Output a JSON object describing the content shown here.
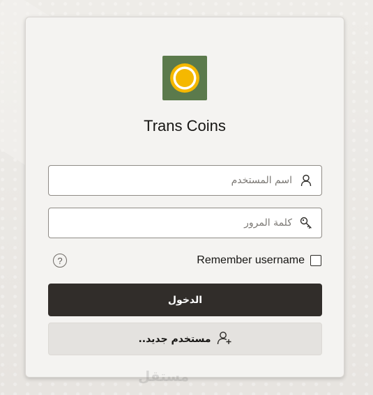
{
  "app": {
    "title": "Trans Coins"
  },
  "login": {
    "username_placeholder": "اسم المستخدم",
    "password_placeholder": "كلمة المرور",
    "remember_label": "Remember username",
    "remember_checked": false,
    "help_symbol": "?",
    "login_button": "الدخول",
    "new_user_button": "مستخدم جديد.."
  },
  "watermark": "مستقل",
  "icons": {
    "logo": "coin-logo-icon",
    "username": "user-icon",
    "password": "key-icon",
    "help": "help-icon",
    "new_user": "add-user-icon"
  },
  "colors": {
    "logo_bg": "#5b7a4c",
    "logo_ring": "#f5b800",
    "primary_button": "#312d2a",
    "secondary_button": "#e4e2df",
    "card_bg": "#f4f3f1",
    "page_bg": "#ebe9e6"
  }
}
